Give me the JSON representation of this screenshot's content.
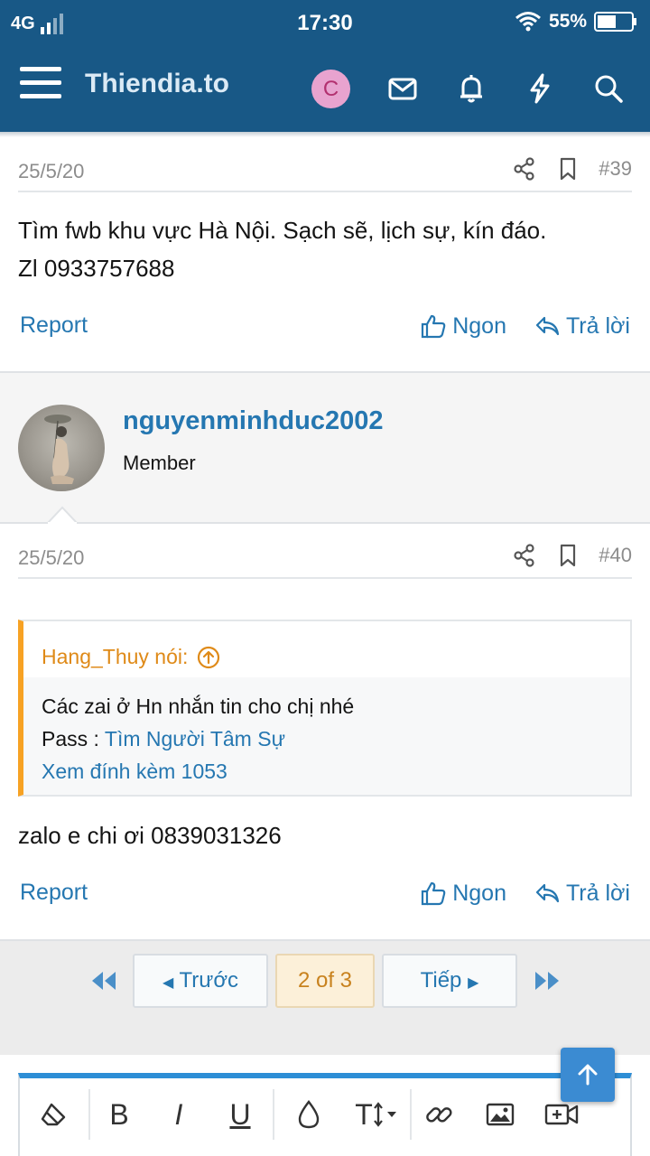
{
  "status_bar": {
    "network": "4G",
    "time": "17:30",
    "battery": "55%"
  },
  "header": {
    "site_title": "Thiendia.to",
    "avatar_letter": "C",
    "icons": [
      "menu-icon",
      "mail-icon",
      "bell-icon",
      "bolt-icon",
      "search-icon"
    ]
  },
  "posts": [
    {
      "date": "25/5/20",
      "number": "#39",
      "body_line1": "Tìm fwb khu vực Hà Nội. Sạch sẽ, lịch sự, kín đáo.",
      "body_line2": "Zl 0933757688",
      "report_label": "Report",
      "like_label": "Ngon",
      "reply_label": "Trả lời"
    },
    {
      "author": "nguyenminhduc2002",
      "author_title": "Member",
      "date": "25/5/20",
      "number": "#40",
      "quote": {
        "author_label": "Hang_Thuy nói:",
        "line1": "Các zai ở Hn nhắn tin cho chị nhé",
        "pass_prefix": "Pass : ",
        "pass_link": "Tìm Người Tâm Sự",
        "attachment_link": "Xem đính kèm 1053"
      },
      "body": "zalo e chi ơi 0839031326",
      "report_label": "Report",
      "like_label": "Ngon",
      "reply_label": "Trả lời"
    }
  ],
  "pagination": {
    "prev_label": "Trước",
    "current_label": "2 of 3",
    "next_label": "Tiếp"
  },
  "editor_toolbar": {
    "bold": "B",
    "italic": "I",
    "underline": "U",
    "text_size": "T"
  },
  "colors": {
    "header_bg": "#185886",
    "link": "#2577b1",
    "quote_accent": "#f7a224",
    "editor_accent": "#2d8ed6"
  }
}
